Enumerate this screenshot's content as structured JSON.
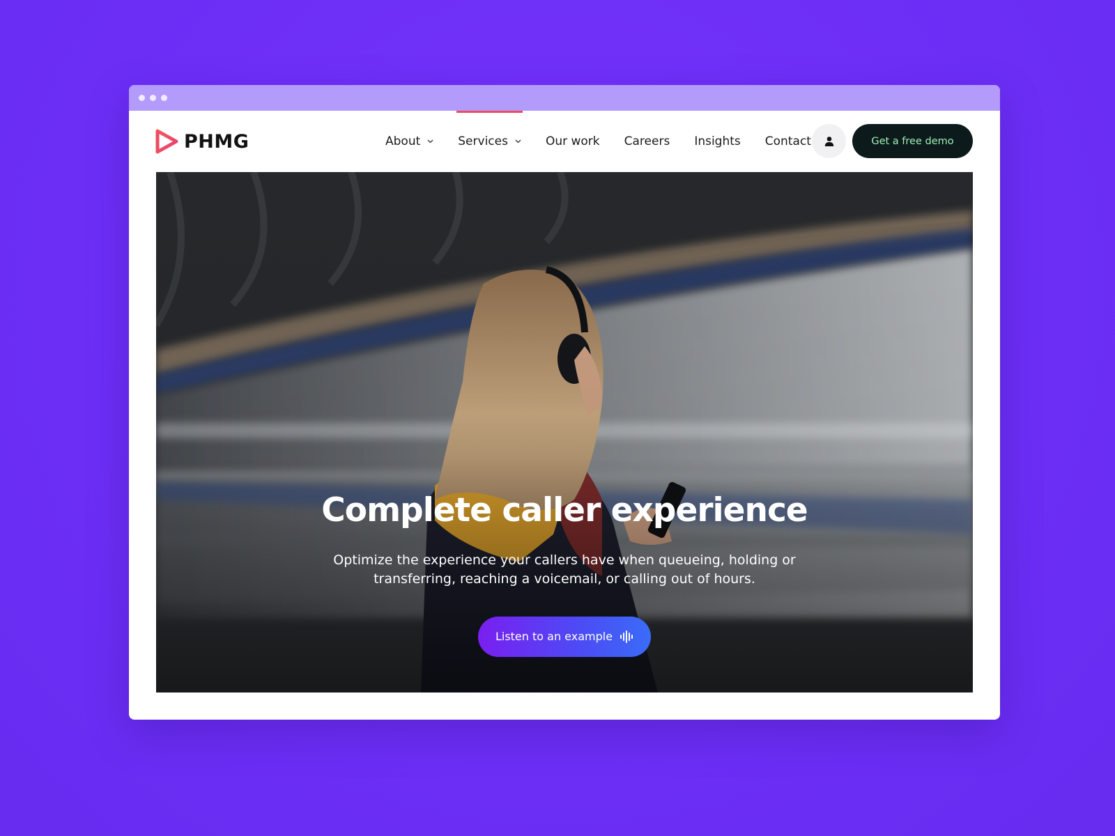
{
  "brand": {
    "name": "PHMG",
    "accent": "#ec4c63",
    "background": "#6f2ff7"
  },
  "nav": {
    "items": [
      {
        "label": "About",
        "has_dropdown": true,
        "active": false
      },
      {
        "label": "Services",
        "has_dropdown": true,
        "active": true
      },
      {
        "label": "Our work",
        "has_dropdown": false,
        "active": false
      },
      {
        "label": "Careers",
        "has_dropdown": false,
        "active": false
      },
      {
        "label": "Insights",
        "has_dropdown": false,
        "active": false
      },
      {
        "label": "Contact",
        "has_dropdown": false,
        "active": false
      }
    ],
    "account_icon": "user-icon",
    "cta_label": "Get a free demo"
  },
  "hero": {
    "title": "Complete caller experience",
    "subtitle": "Optimize the experience your callers have when queueing, holding or transferring, reaching a voicemail, or calling out of hours.",
    "button_label": "Listen to an example",
    "button_icon": "sound-wave-icon",
    "image_icon": "woman-with-headphones-photo"
  }
}
